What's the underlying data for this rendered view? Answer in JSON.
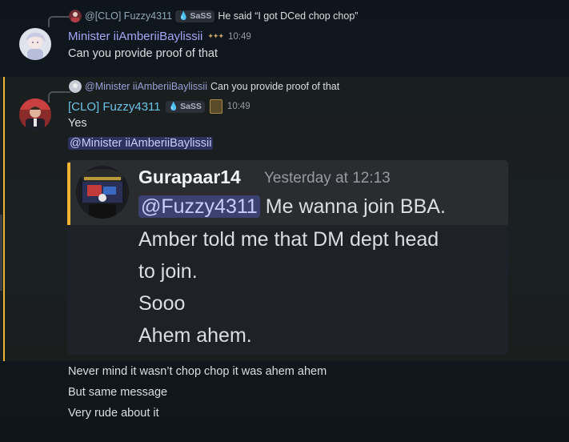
{
  "msg1": {
    "reply": {
      "author": "@[CLO] Fuzzy4311",
      "tag": "SaSS",
      "text": "He said “I got DCed chop chop”"
    },
    "author": "Minister iiAmberiiBaylissii",
    "author_color": "#a4a7f7",
    "badge_icon": "stars-icon",
    "time": "10:49",
    "text": "Can you provide proof of that"
  },
  "msg2": {
    "reply": {
      "author": "@Minister iiAmberiiBaylissii",
      "text": "Can you provide proof of that"
    },
    "author": "[CLO] Fuzzy4311",
    "author_color": "#6cc3e8",
    "tag": "SaSS",
    "badge_icon": "lantern-icon",
    "time": "10:49",
    "lines": [
      "Yes"
    ],
    "mention": "@Minister iiAmberiiBaylissii",
    "embed": {
      "author": "Gurapaar14",
      "time": "Yesterday at 12:13",
      "mention": "@Fuzzy4311",
      "first_line_rest": " Me wanna join BBA.",
      "lines": [
        "Amber told me that DM dept head",
        "to join.",
        "Sooo",
        "Ahem ahem."
      ]
    }
  },
  "msg3": {
    "lines": [
      "Never mind it wasn’t chop chop it was ahem ahem",
      "But same message",
      "Very rude about it"
    ]
  },
  "colors": {
    "highlight": "#f0b232",
    "mention_bg": "#3c4270",
    "background": "#111820"
  }
}
